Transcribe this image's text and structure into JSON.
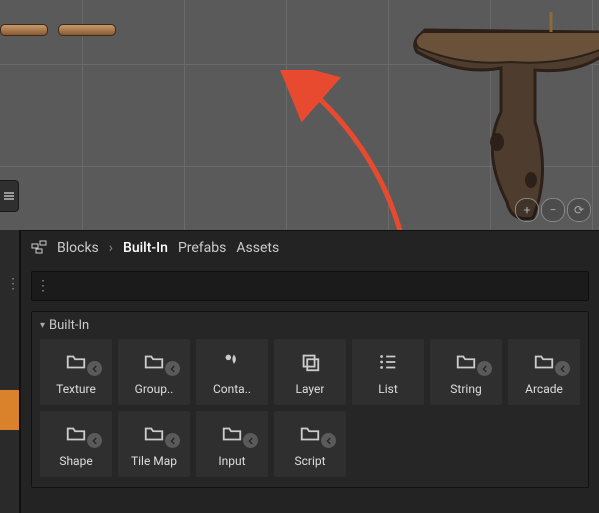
{
  "breadcrumbs": {
    "items": [
      "Blocks",
      "Built-In",
      "Prefabs",
      "Assets"
    ],
    "separator": "›",
    "active_index": 1
  },
  "search": {
    "value": "",
    "placeholder": ""
  },
  "section": {
    "title": "Built-In",
    "items": [
      {
        "label": "Texture",
        "icon": "folder",
        "badge": true
      },
      {
        "label": "Group..",
        "icon": "folder",
        "badge": true
      },
      {
        "label": "Conta..",
        "icon": "drop",
        "badge": false
      },
      {
        "label": "Layer",
        "icon": "layers",
        "badge": false
      },
      {
        "label": "List",
        "icon": "list",
        "badge": false
      },
      {
        "label": "String",
        "icon": "folder",
        "badge": true
      },
      {
        "label": "Arcade",
        "icon": "folder",
        "badge": true
      },
      {
        "label": "Shape",
        "icon": "folder",
        "badge": true
      },
      {
        "label": "Tile Map",
        "icon": "folder",
        "badge": true
      },
      {
        "label": "Input",
        "icon": "folder",
        "badge": true
      },
      {
        "label": "Script",
        "icon": "folder",
        "badge": true
      }
    ]
  },
  "colors": {
    "arrow": "#e84a2f",
    "accent": "#d9822b",
    "cliff_fill": "#5b4a3b",
    "cliff_top": "#6a513a",
    "cliff_outline": "#2c2018"
  }
}
